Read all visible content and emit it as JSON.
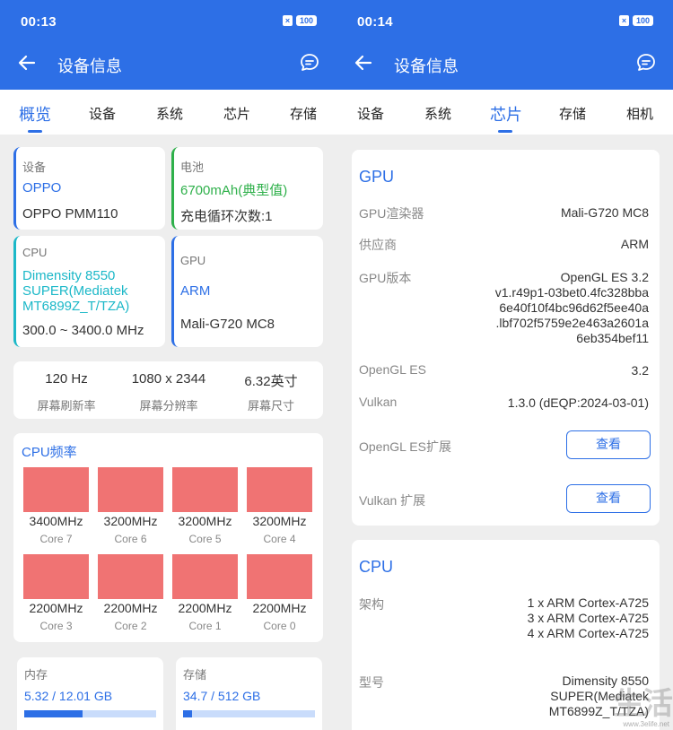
{
  "left": {
    "status_time": "00:13",
    "sim_label": "×",
    "battery_label": "100",
    "title": "设备信息",
    "tabs": [
      "概览",
      "设备",
      "系统",
      "芯片",
      "存储"
    ],
    "device": {
      "label": "设备",
      "brand": "OPPO",
      "model": "OPPO PMM110"
    },
    "battery": {
      "label": "电池",
      "capacity": "6700mAh(典型值)",
      "cycles": "充电循环次数:1"
    },
    "cpu": {
      "label": "CPU",
      "name_line1": "Dimensity 8550",
      "name_line2": "SUPER(Mediatek",
      "name_line3": "MT6899Z_T/TZA)",
      "freq": "300.0 ~ 3400.0 MHz"
    },
    "gpu": {
      "label": "GPU",
      "vendor": "ARM",
      "model": "Mali-G720 MC8"
    },
    "screen": [
      {
        "value": "120 Hz",
        "label": "屏幕刷新率"
      },
      {
        "value": "1080 x 2344",
        "label": "屏幕分辨率"
      },
      {
        "value": "6.32英寸",
        "label": "屏幕尺寸"
      }
    ],
    "cpu_freq": {
      "title": "CPU频率",
      "cores": [
        {
          "freq": "3400MHz",
          "name": "Core 7"
        },
        {
          "freq": "3200MHz",
          "name": "Core 6"
        },
        {
          "freq": "3200MHz",
          "name": "Core 5"
        },
        {
          "freq": "3200MHz",
          "name": "Core 4"
        },
        {
          "freq": "2200MHz",
          "name": "Core 3"
        },
        {
          "freq": "2200MHz",
          "name": "Core 2"
        },
        {
          "freq": "2200MHz",
          "name": "Core 1"
        },
        {
          "freq": "2200MHz",
          "name": "Core 0"
        }
      ]
    },
    "memory": {
      "label": "内存",
      "value": "5.32 / 12.01 GB",
      "fraction": 0.443
    },
    "storage": {
      "label": "存储",
      "value": "34.7 / 512 GB",
      "fraction": 0.068
    }
  },
  "right": {
    "status_time": "00:14",
    "sim_label": "×",
    "battery_label": "100",
    "title": "设备信息",
    "tabs": [
      "设备",
      "系统",
      "芯片",
      "存储",
      "相机"
    ],
    "gpu_section": {
      "title": "GPU",
      "rows": [
        {
          "label": "GPU渲染器",
          "value": "Mali-G720 MC8"
        },
        {
          "label": "供应商",
          "value": "ARM"
        },
        {
          "label": "GPU版本",
          "lines": [
            "OpenGL ES 3.2",
            "v1.r49p1-03bet0.4fc328bba",
            "6e40f10f4bc96d62f5ee40a",
            ".lbf702f5759e2e463a2601a",
            "6eb354bef11"
          ]
        },
        {
          "label": "OpenGL ES",
          "value": "3.2"
        },
        {
          "label": "Vulkan",
          "value": "1.3.0 (dEQP:2024-03-01)"
        }
      ],
      "opengl_ext_label": "OpenGL ES扩展",
      "vulkan_ext_label": "Vulkan 扩展",
      "view_button": "查看"
    },
    "cpu_section": {
      "title": "CPU",
      "arch_label": "架构",
      "arch_lines": [
        "1 x ARM Cortex-A725",
        "3 x ARM Cortex-A725",
        "4 x ARM Cortex-A725"
      ],
      "model_label": "型号",
      "model_lines": [
        "Dimensity 8550",
        "SUPER(Mediatek",
        "MT6899Z_T/TZA)"
      ]
    },
    "watermark": "生活",
    "watermark_url": "www.3elife.net"
  },
  "colors": {
    "primary": "#2d6fe6",
    "green": "#2eb04a",
    "teal": "#1cb8c8",
    "core": "#f07373"
  }
}
